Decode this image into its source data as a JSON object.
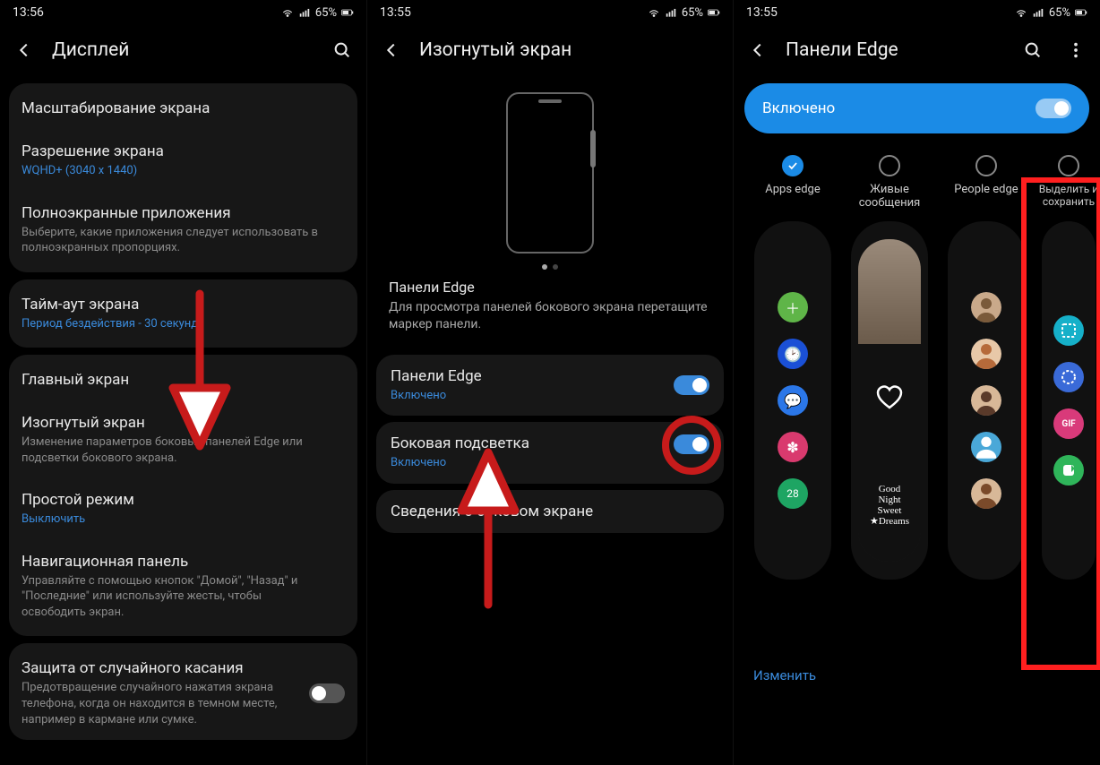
{
  "accent": "#3a8adb",
  "status": {
    "time1": "13:56",
    "time2": "13:55",
    "time3": "13:55",
    "battery": "65%"
  },
  "screen1": {
    "title": "Дисплей",
    "items": {
      "scale": {
        "t": "Масштабирование экрана"
      },
      "res": {
        "t": "Разрешение экрана",
        "s": "WQHD+ (3040 x 1440)"
      },
      "full": {
        "t": "Полноэкранные приложения",
        "s": "Выберите, какие приложения следует использовать в полноэкранных пропорциях."
      },
      "timeout": {
        "t": "Тайм-аут экрана",
        "s": "Период бездействия - 30 секунд"
      },
      "home": {
        "t": "Главный экран"
      },
      "edge": {
        "t": "Изогнутый экран",
        "s": "Изменение параметров боковых панелей Edge или подсветки бокового экрана."
      },
      "simple": {
        "t": "Простой режим",
        "s": "Выключить"
      },
      "nav": {
        "t": "Навигационная панель",
        "s": "Управляйте с помощью кнопок \"Домой\", \"Назад\" и \"Последние\" или используйте жесты, чтобы освободить экран."
      },
      "accid": {
        "t": "Защита от случайного касания",
        "s": "Предотвращение случайного нажатия экрана телефона, когда он находится в темном месте, например в кармане или сумке."
      }
    }
  },
  "screen2": {
    "title": "Изогнутый экран",
    "info_t": "Панели Edge",
    "info_s": "Для просмотра панелей бокового экрана перетащите маркер панели.",
    "panels": {
      "t": "Панели Edge",
      "s": "Включено"
    },
    "light": {
      "t": "Боковая подсветка",
      "s": "Включено"
    },
    "about": {
      "t": "Сведения о боковом экране"
    }
  },
  "screen3": {
    "title": "Панели Edge",
    "enabled": "Включено",
    "change": "Изменить",
    "cols": {
      "apps": "Apps edge",
      "live": "Живые сообщения",
      "people": "People edge",
      "select": "Выделить и сохранить"
    }
  }
}
